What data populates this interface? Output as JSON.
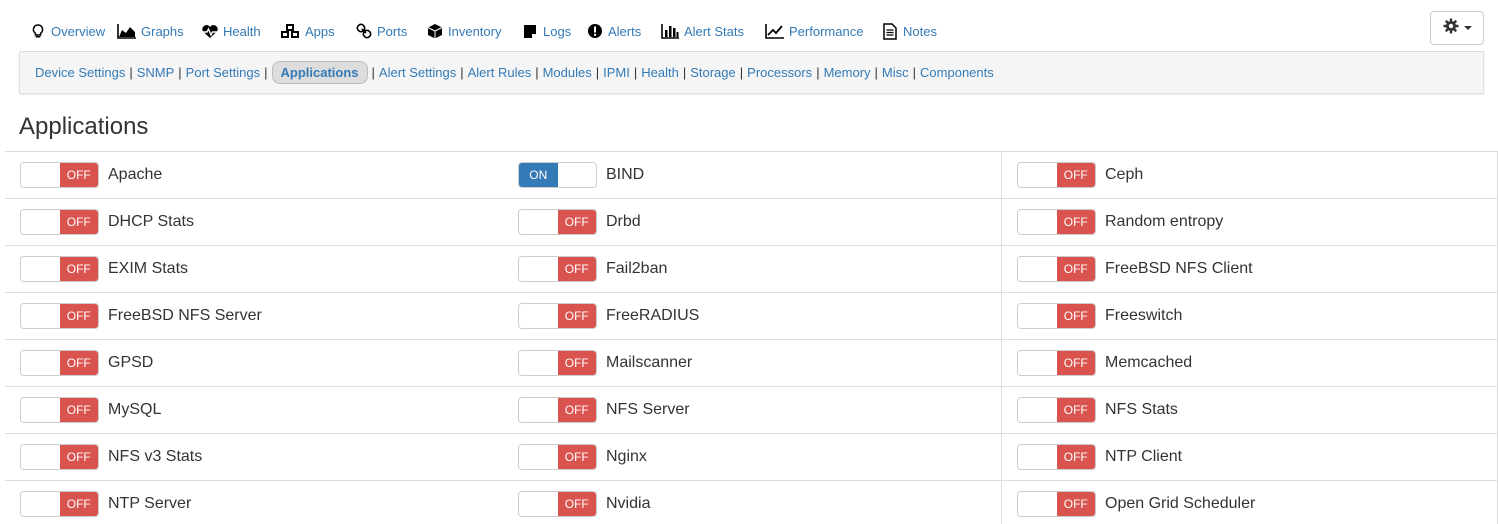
{
  "topnav": {
    "tabs": [
      {
        "label": "Overview",
        "icon": "lightbulb-icon"
      },
      {
        "label": "Graphs",
        "icon": "area-chart-icon"
      },
      {
        "label": "Health",
        "icon": "heartbeat-icon"
      },
      {
        "label": "Apps",
        "icon": "cubes-icon"
      },
      {
        "label": "Ports",
        "icon": "link-icon"
      },
      {
        "label": "Inventory",
        "icon": "cube-icon"
      },
      {
        "label": "Logs",
        "icon": "sticky-note-icon"
      },
      {
        "label": "Alerts",
        "icon": "exclamation-circle-icon"
      },
      {
        "label": "Alert Stats",
        "icon": "bar-chart-icon"
      },
      {
        "label": "Performance",
        "icon": "line-chart-icon"
      },
      {
        "label": "Notes",
        "icon": "file-text-icon"
      }
    ],
    "settings_icon": "gear-icon"
  },
  "subnav": {
    "items": [
      "Device Settings",
      "SNMP",
      "Port Settings",
      "Applications",
      "Alert Settings",
      "Alert Rules",
      "Modules",
      "IPMI",
      "Health",
      "Storage",
      "Processors",
      "Memory",
      "Misc",
      "Components"
    ],
    "separator": "|",
    "active": "Applications"
  },
  "page_title": "Applications",
  "toggle_labels": {
    "on": "ON",
    "off": "OFF"
  },
  "apps": [
    {
      "name": "Apache",
      "enabled": false
    },
    {
      "name": "BIND",
      "enabled": true
    },
    {
      "name": "Ceph",
      "enabled": false
    },
    {
      "name": "DHCP Stats",
      "enabled": false
    },
    {
      "name": "Drbd",
      "enabled": false
    },
    {
      "name": "Random entropy",
      "enabled": false
    },
    {
      "name": "EXIM Stats",
      "enabled": false
    },
    {
      "name": "Fail2ban",
      "enabled": false
    },
    {
      "name": "FreeBSD NFS Client",
      "enabled": false
    },
    {
      "name": "FreeBSD NFS Server",
      "enabled": false
    },
    {
      "name": "FreeRADIUS",
      "enabled": false
    },
    {
      "name": "Freeswitch",
      "enabled": false
    },
    {
      "name": "GPSD",
      "enabled": false
    },
    {
      "name": "Mailscanner",
      "enabled": false
    },
    {
      "name": "Memcached",
      "enabled": false
    },
    {
      "name": "MySQL",
      "enabled": false
    },
    {
      "name": "NFS Server",
      "enabled": false
    },
    {
      "name": "NFS Stats",
      "enabled": false
    },
    {
      "name": "NFS v3 Stats",
      "enabled": false
    },
    {
      "name": "Nginx",
      "enabled": false
    },
    {
      "name": "NTP Client",
      "enabled": false
    },
    {
      "name": "NTP Server",
      "enabled": false
    },
    {
      "name": "Nvidia",
      "enabled": false
    },
    {
      "name": "Open Grid Scheduler",
      "enabled": false
    }
  ],
  "colors": {
    "link": "#337ab7",
    "off": "#d9534f",
    "on": "#337ab7"
  }
}
